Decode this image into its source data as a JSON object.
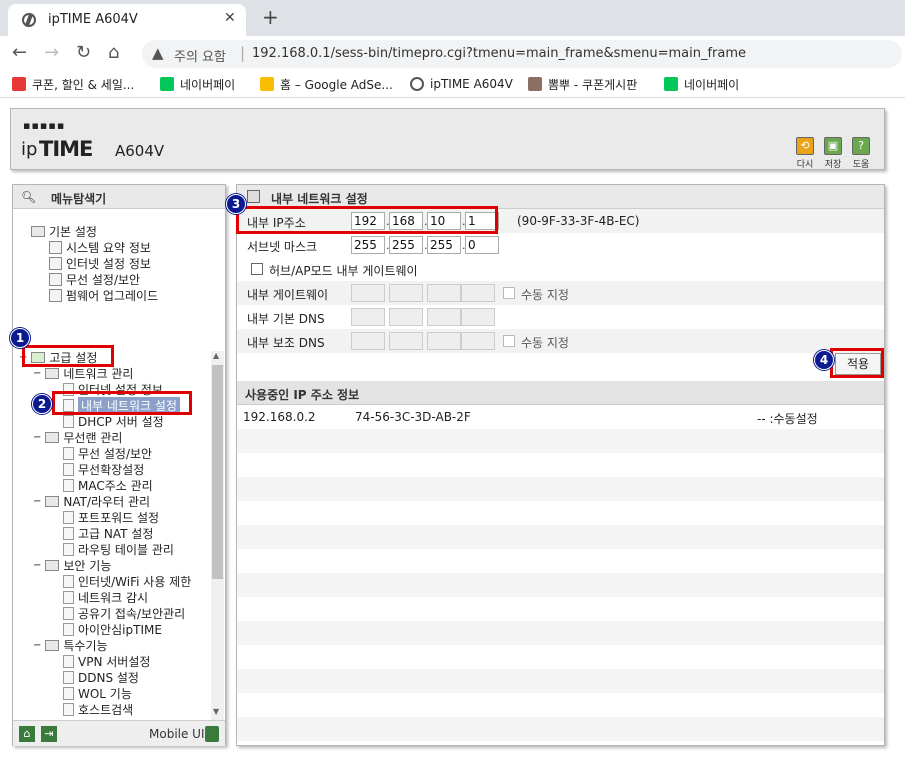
{
  "browser": {
    "tab_title": "ipTIME A604V",
    "tab_close": "✕",
    "new_tab": "+",
    "url_warning": "주의 요함",
    "url_separator": "|",
    "url": "192.168.0.1/sess-bin/timepro.cgi?tmenu=main_frame&smenu=main_frame",
    "bookmarks": [
      {
        "label": "쿠폰, 할인 & 세일...",
        "icon": "lightning-icon",
        "color": "#e53935"
      },
      {
        "label": "네이버페이",
        "icon": "naver-pay-icon",
        "color": "#03c75a"
      },
      {
        "label": "홈 – Google AdSe...",
        "icon": "adsense-icon",
        "color": "#fbbc04"
      },
      {
        "label": "ipTIME A604V",
        "icon": "globe-icon",
        "color": "#555555"
      },
      {
        "label": "뽐뿌 - 쿠폰게시판",
        "icon": "ppomppu-icon",
        "color": "#8d6e63"
      },
      {
        "label": "네이버페이",
        "icon": "naver-pay-icon",
        "color": "#03c75a"
      }
    ]
  },
  "header": {
    "logo_dots": "▪▪▪▪▪",
    "logo_ip": "ip",
    "logo_time": "TIME",
    "model": "A604V",
    "buttons": [
      {
        "label": "다시",
        "icon": "refresh-icon",
        "color": "#e8a317"
      },
      {
        "label": "저장",
        "icon": "save-icon",
        "color": "#6aa84f"
      },
      {
        "label": "도움",
        "icon": "help-icon",
        "color": "#6aa84f"
      }
    ]
  },
  "sidebar": {
    "title": "메뉴탐색기",
    "basic": {
      "label": "기본 설정",
      "items": [
        "시스템 요약 정보",
        "인터넷 설정 정보",
        "무선 설정/보안",
        "펌웨어 업그레이드"
      ]
    },
    "advanced": {
      "label": "고급 설정",
      "groups": [
        {
          "label": "네트워크 관리",
          "items": [
            "인터넷 설정 정보",
            "내부 네트워크 설정",
            "DHCP 서버 설정"
          ]
        },
        {
          "label": "무선랜 관리",
          "items": [
            "무선 설정/보안",
            "무선확장설정",
            "MAC주소 관리"
          ]
        },
        {
          "label": "NAT/라우터 관리",
          "items": [
            "포트포워드 설정",
            "고급 NAT 설정",
            "라우팅 테이블 관리"
          ]
        },
        {
          "label": "보안 기능",
          "items": [
            "인터넷/WiFi 사용 제한",
            "네트워크 감시",
            "공유기 접속/보안관리",
            "아이안심ipTIME"
          ]
        },
        {
          "label": "특수기능",
          "items": [
            "VPN 서버설정",
            "DDNS 설정",
            "WOL 기능",
            "호스트검색"
          ]
        }
      ]
    },
    "mobile_ui": "Mobile UI"
  },
  "content": {
    "title": "내부 네트워크 설정",
    "ip_label": "내부 IP주소",
    "ip": [
      "192",
      "168",
      "10",
      "1"
    ],
    "mac": "(90-9F-33-3F-4B-EC)",
    "subnet_label": "서브넷 마스크",
    "subnet": [
      "255",
      "255",
      "255",
      "0"
    ],
    "hub_ap_label": "허브/AP모드 내부 게이트웨이",
    "gateway_label": "내부 게이트웨이",
    "manual_label": "수동 지정",
    "dns1_label": "내부 기본 DNS",
    "dns2_label": "내부 보조 DNS",
    "dns2_manual_label": "수동 지정",
    "apply": "적용",
    "used_title": "사용중인 IP 주소 정보",
    "dhcp_rows": [
      {
        "ip": "192.168.0.2",
        "mac": "74-56-3C-3D-AB-2F",
        "type": "-- :수동설정"
      }
    ]
  },
  "annotations": [
    "1",
    "2",
    "3",
    "4"
  ],
  "colors": {
    "annotation_red": "#e00000",
    "badge_blue": "#0b1a8f"
  }
}
